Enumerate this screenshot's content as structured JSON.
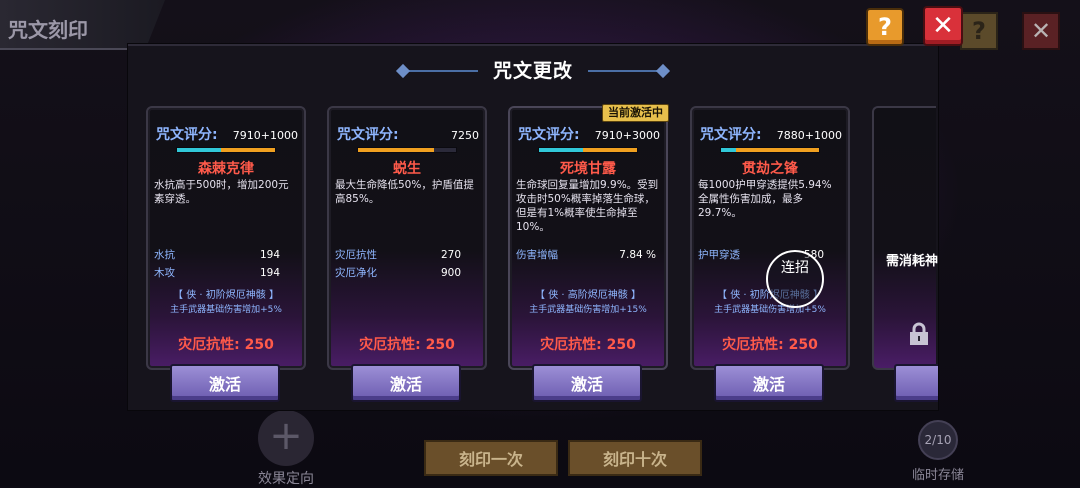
{
  "background": {
    "page_title": "咒文刻印",
    "effect_target": "效果定向",
    "engrave_once": "刻印一次",
    "engrave_ten": "刻印十次",
    "temp_storage": "临时存储",
    "temp_count": "2/10"
  },
  "dialog": {
    "title": "咒文更改",
    "help_label": "?",
    "close_label": "✕",
    "active_badge": "当前激活中",
    "partial_card_label": "需消耗神",
    "combo_label": "连招"
  },
  "cards": [
    {
      "score_label": "咒文评分:",
      "score": "7910+1000",
      "bar_cyan": 0.45,
      "bar_orange": 0.55,
      "name": "森棘克律",
      "desc": "水抗高于500时，增加200元素穿透。",
      "stats": [
        {
          "name": "水抗",
          "value": "194"
        },
        {
          "name": "木攻",
          "value": "194"
        }
      ],
      "set_name": "【 侠 · 初阶烬厄神骸 】",
      "set_effect": "主手武器基础伤害增加+5%",
      "resist": "灾厄抗性: 250",
      "button": "激活"
    },
    {
      "score_label": "咒文评分:",
      "score": "7250",
      "bar_cyan": 0.0,
      "bar_orange": 0.78,
      "name": "蜕生",
      "desc": "最大生命降低50%，护盾值提高85%。",
      "stats": [
        {
          "name": "灾厄抗性",
          "value": "270"
        },
        {
          "name": "灾厄净化",
          "value": "900"
        }
      ],
      "set_name": "",
      "set_effect": "",
      "resist": "灾厄抗性: 250",
      "button": "激活"
    },
    {
      "score_label": "咒文评分:",
      "score": "7910+3000",
      "bar_cyan": 0.45,
      "bar_orange": 0.55,
      "name": "死境甘露",
      "desc": "生命球回复量增加9.9%。受到攻击时50%概率掉落生命球，但是有1%概率使生命掉至10%。",
      "stats": [
        {
          "name": "伤害增幅",
          "value": "7.84 %"
        }
      ],
      "set_name": "【 侠 · 高阶烬厄神骸 】",
      "set_effect": "主手武器基础伤害增加+15%",
      "resist": "灾厄抗性: 250",
      "button": "激活"
    },
    {
      "score_label": "咒文评分:",
      "score": "7880+1000",
      "bar_cyan": 0.15,
      "bar_orange": 0.85,
      "name": "贯劫之锋",
      "desc": "每1000护甲穿透提供5.94%全属性伤害加成，最多29.7%。",
      "stats": [
        {
          "name": "护甲穿透",
          "value": "580"
        }
      ],
      "set_name": "【 侠 · 初阶烬厄神骸 】",
      "set_effect": "主手武器基础伤害增加+5%",
      "resist": "灾厄抗性: 250",
      "button": "激活"
    }
  ],
  "colors": {
    "score_label": "#8fb6ff",
    "rune_name": "#ff5a4a",
    "bar_cyan": "#31c8d8",
    "bar_orange": "#f0a020",
    "activate_button": "#8a7cc8",
    "help_button": "#e89a2c",
    "close_button": "#d9313a"
  },
  "icons": {
    "help": "question-mark-icon",
    "close": "close-icon",
    "lock": "lock-icon",
    "plus": "plus-icon"
  }
}
